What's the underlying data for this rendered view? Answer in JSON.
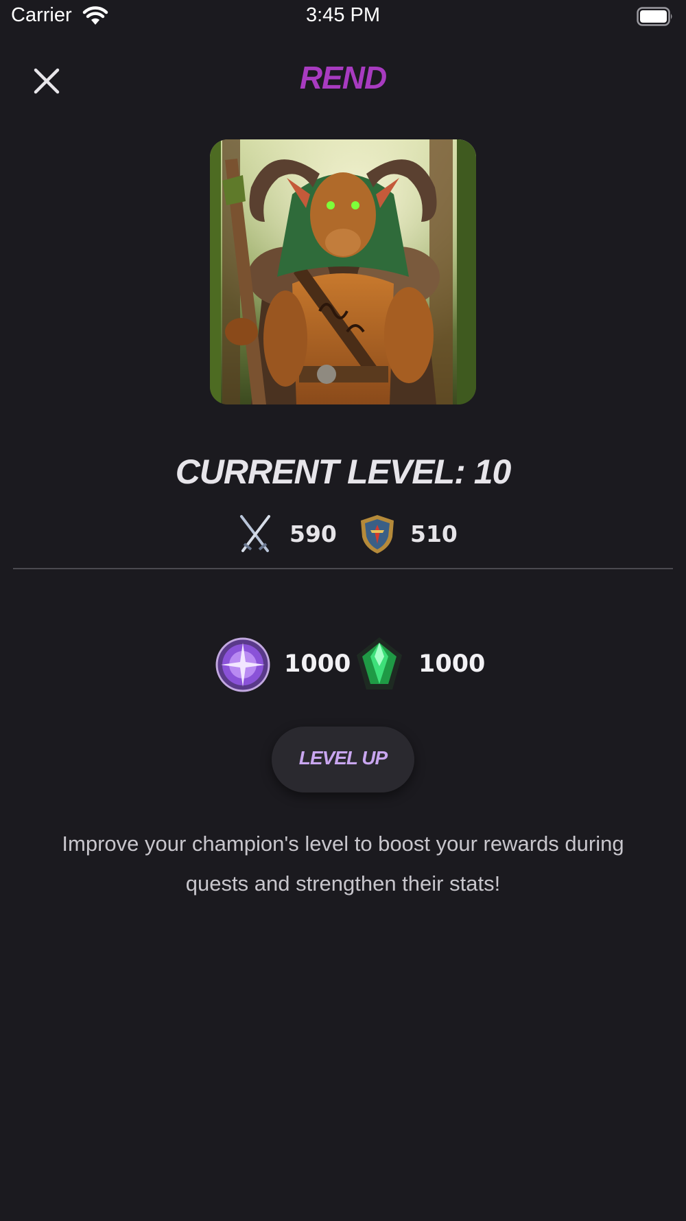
{
  "status_bar": {
    "carrier": "Carrier",
    "time": "3:45 PM",
    "icons": [
      "wifi-icon",
      "battery-icon"
    ]
  },
  "header": {
    "title": "REND",
    "close_icon": "close-icon"
  },
  "champion": {
    "portrait": "champion-portrait",
    "level_text": "CURRENT LEVEL: 10",
    "stats": [
      {
        "icon": "crossed-swords-icon",
        "value": "590"
      },
      {
        "icon": "shield-icon",
        "value": "510"
      }
    ]
  },
  "costs": [
    {
      "icon": "purple-orb-icon",
      "value": "1000"
    },
    {
      "icon": "green-gem-icon",
      "value": "1000"
    }
  ],
  "level_up_button": {
    "label": "LEVEL UP"
  },
  "description": "Improve your champion's level to boost your rewards during quests and strengthen their stats!",
  "colors": {
    "background": "#1b1a1f",
    "title": "#a83bc0",
    "button_label": "#c9a6f0",
    "button_bg": "#2a292f"
  }
}
